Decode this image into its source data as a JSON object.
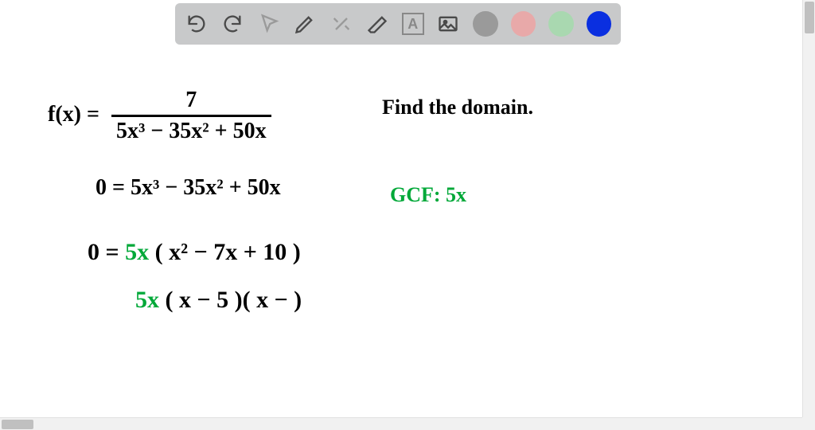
{
  "toolbar": {
    "undo": "undo-icon",
    "redo": "redo-icon",
    "pointer": "pointer-icon",
    "pen": "pen-icon",
    "tools": "tools-icon",
    "eraser": "eraser-icon",
    "textbox_label": "A",
    "image": "image-icon",
    "colors": {
      "gray": "#9a9a9a",
      "pink": "#e8a9a9",
      "green": "#a9d8b0",
      "blue": "#0a2fe0"
    }
  },
  "content": {
    "line1_lhs": "f(x) =",
    "line1_num": "7",
    "line1_den": "5x³ − 35x² + 50x",
    "line1_prompt": "Find the domain.",
    "line2": "0 = 5x³ − 35x² + 50x",
    "gcf": "GCF: 5x",
    "line3_a": "0 = ",
    "line3_b": "5x",
    "line3_c": " ( x² − 7x + 10 )",
    "line4_a": "5x",
    "line4_b": " ( x − 5  )( x −    )"
  }
}
